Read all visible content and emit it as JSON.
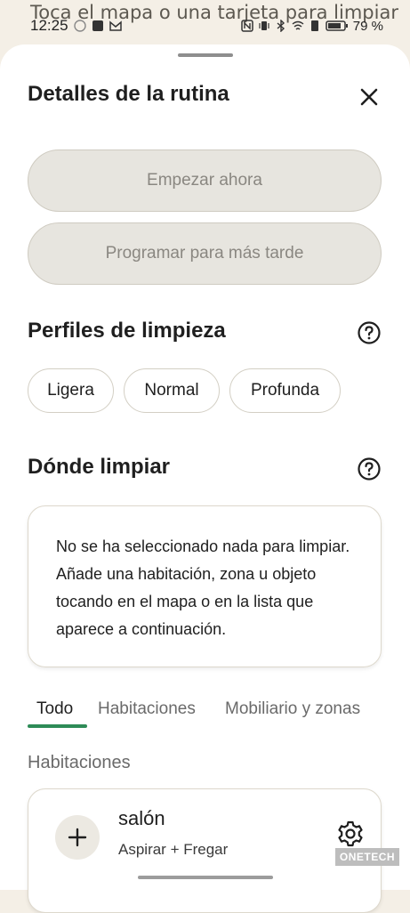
{
  "background_hint": "Toca el mapa o una tarjeta para limpiar",
  "status_bar": {
    "time": "12:25",
    "battery": "79 %"
  },
  "sheet": {
    "title": "Detalles de la rutina",
    "buttons": {
      "start_now": "Empezar ahora",
      "schedule_later": "Programar para más tarde"
    },
    "profiles": {
      "title": "Perfiles de limpieza",
      "options": [
        "Ligera",
        "Normal",
        "Profunda"
      ]
    },
    "where": {
      "title": "Dónde limpiar",
      "empty_message": "No se ha seleccionado nada para limpiar. Añade una habitación, zona u objeto tocando en el mapa o en la lista que aparece a continuación."
    },
    "tabs": [
      "Todo",
      "Habitaciones",
      "Mobiliario y zonas"
    ],
    "active_tab": "Todo",
    "group_label": "Habitaciones",
    "room": {
      "name": "salón",
      "mode": "Aspirar + Fregar"
    }
  },
  "watermark": "ONETECH",
  "colors": {
    "accent": "#2e8b57",
    "disabled_button_bg": "#e7e5df",
    "disabled_text": "#8a8781"
  }
}
